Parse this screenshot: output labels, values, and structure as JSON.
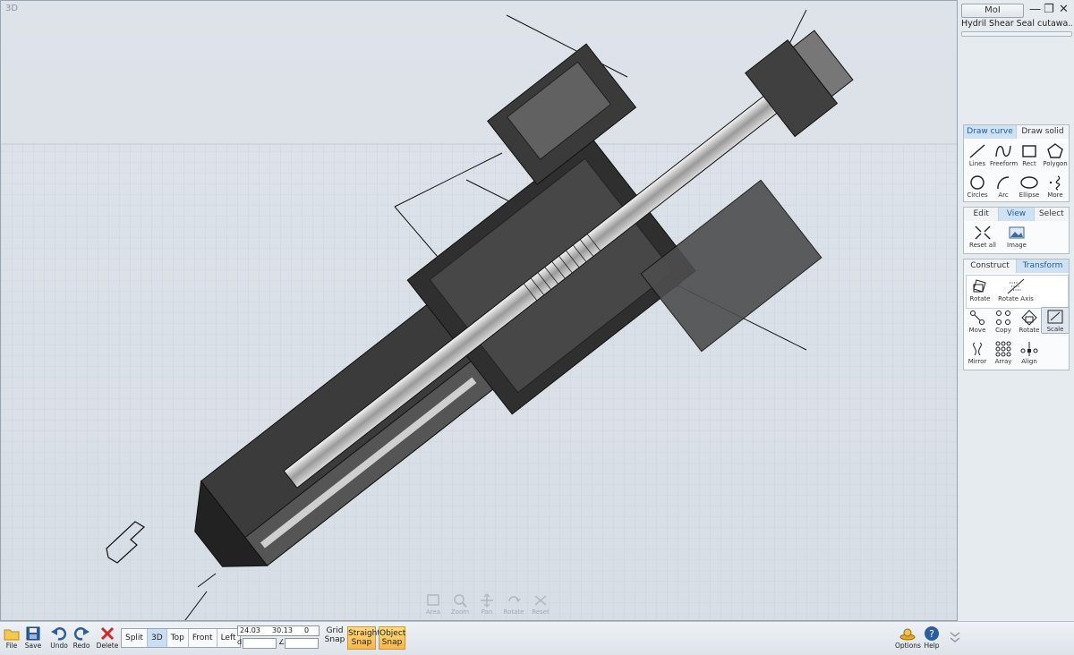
{
  "viewport": {
    "label": "3D"
  },
  "nav_tools": [
    {
      "name": "area",
      "label": "Area"
    },
    {
      "name": "zoom",
      "label": "Zoom"
    },
    {
      "name": "pan",
      "label": "Pan"
    },
    {
      "name": "rotate",
      "label": "Rotate"
    },
    {
      "name": "reset",
      "label": "Reset"
    }
  ],
  "panel": {
    "app_title": "MoI",
    "document_name": "Hydril Shear Seal cutawa...",
    "tabs1": [
      {
        "label": "Draw curve",
        "active": true
      },
      {
        "label": "Draw solid",
        "active": false
      }
    ],
    "draw_curve_tools": [
      {
        "label": "Lines",
        "icon": "lines-icon"
      },
      {
        "label": "Freeform",
        "icon": "freeform-icon"
      },
      {
        "label": "Rect",
        "icon": "rect-icon"
      },
      {
        "label": "Polygon",
        "icon": "polygon-icon"
      },
      {
        "label": "Circles",
        "icon": "circle-icon"
      },
      {
        "label": "Arc",
        "icon": "arc-icon"
      },
      {
        "label": "Ellipse",
        "icon": "ellipse-icon"
      },
      {
        "label": "More",
        "icon": "more-icon"
      }
    ],
    "tabs2": [
      {
        "label": "Edit",
        "active": false
      },
      {
        "label": "View",
        "active": true
      },
      {
        "label": "Select",
        "active": false
      }
    ],
    "view_tools": [
      {
        "label": "Reset all",
        "icon": "reset-all-icon"
      },
      {
        "label": "Image",
        "icon": "image-icon"
      }
    ],
    "tabs3": [
      {
        "label": "Construct",
        "active": false
      },
      {
        "label": "Transform",
        "active": true
      }
    ],
    "rotate_tools": [
      {
        "label": "Rotate",
        "icon": "rotate-icon"
      },
      {
        "label": "Rotate Axis",
        "icon": "rotate-axis-icon"
      }
    ],
    "transform_tools": [
      {
        "label": "Move",
        "icon": "move-icon"
      },
      {
        "label": "Copy",
        "icon": "copy-icon"
      },
      {
        "label": "Rotate",
        "icon": "rotate-icon"
      },
      {
        "label": "Scale",
        "icon": "scale-icon"
      },
      {
        "label": "Mirror",
        "icon": "mirror-icon"
      },
      {
        "label": "Array",
        "icon": "array-icon"
      },
      {
        "label": "Align",
        "icon": "align-icon"
      }
    ]
  },
  "bottombar": {
    "file": "File",
    "save": "Save",
    "undo": "Undo",
    "redo": "Redo",
    "delete": "Delete",
    "views": [
      {
        "label": "Split",
        "active": false
      },
      {
        "label": "3D",
        "active": true
      },
      {
        "label": "Top",
        "active": false
      },
      {
        "label": "Front",
        "active": false
      },
      {
        "label": "Left",
        "active": false
      }
    ],
    "coord_x": "24.03",
    "coord_y": "30.13",
    "coord_z": "0",
    "d_label": "d",
    "angle_label": "∠",
    "grid_snap_1": "Grid",
    "grid_snap_2": "Snap",
    "straight_1": "Straight",
    "straight_2": "Snap",
    "object_1": "Object",
    "object_2": "Snap",
    "options": "Options",
    "help": "Help"
  },
  "colors": {
    "accent": "#cfe2f5",
    "snap_on": "#f5b84b",
    "viewport_bg": "#dde3e9"
  }
}
